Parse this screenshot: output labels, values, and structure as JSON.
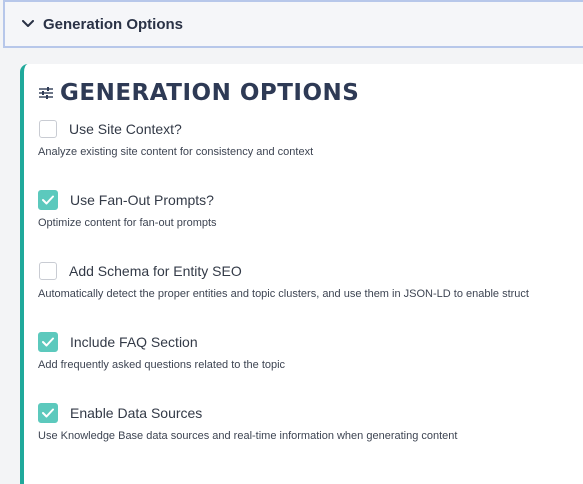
{
  "accordion": {
    "title": "Generation Options",
    "icon": "chevron-down-icon"
  },
  "panel": {
    "title": "GENERATION OPTIONS",
    "icon": "sliders-icon",
    "accent_color": "#20a99b"
  },
  "options": [
    {
      "label": "Use Site Context?",
      "description": "Analyze existing site content for consistency and context",
      "checked": false
    },
    {
      "label": "Use Fan-Out Prompts?",
      "description": "Optimize content for fan-out prompts",
      "checked": true
    },
    {
      "label": "Add Schema for Entity SEO",
      "description": "Automatically detect the proper entities and topic clusters, and use them in JSON-LD to enable struct",
      "checked": false
    },
    {
      "label": "Include FAQ Section",
      "description": "Add frequently asked questions related to the topic",
      "checked": true
    },
    {
      "label": "Enable Data Sources",
      "description": "Use Knowledge Base data sources and real-time information when generating content",
      "checked": true
    }
  ],
  "colors": {
    "checkbox_checked": "#5cc9bd",
    "header_border": "#b7c7ea"
  }
}
